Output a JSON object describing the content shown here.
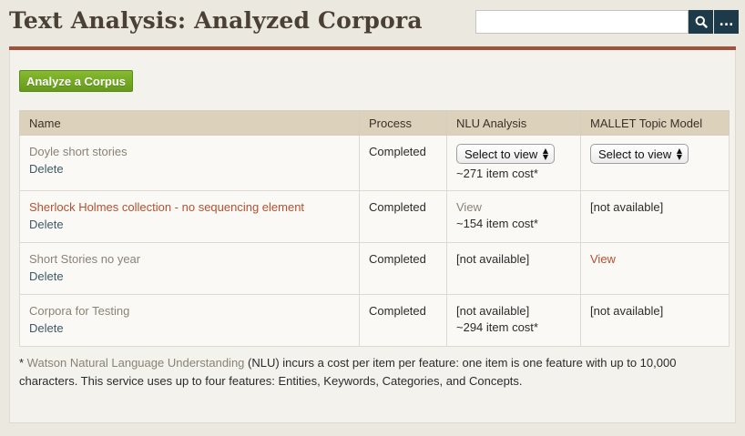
{
  "header": {
    "title": "Text Analysis: Analyzed Corpora",
    "search_placeholder": "",
    "search_icon": "magnifier",
    "more_label": "..."
  },
  "colors": {
    "accent_rule": "#a0533a",
    "button_green": "#75aa25",
    "search_button": "#1c3a4a",
    "active_link": "#b5502f",
    "muted_link": "#8a8276"
  },
  "actions": {
    "analyze_label": "Analyze a Corpus"
  },
  "table": {
    "headers": [
      "Name",
      "Process",
      "NLU Analysis",
      "MALLET Topic Model"
    ],
    "rows": [
      {
        "name": "Doyle short stories",
        "delete": "Delete",
        "process": "Completed",
        "nlu_select": "Select to view",
        "nlu_cost": "~271 item cost*",
        "mallet_select": "Select to view"
      },
      {
        "name": "Sherlock Holmes collection - no sequencing element",
        "delete": "Delete",
        "process": "Completed",
        "nlu_view": "View",
        "nlu_cost": "~154 item cost*",
        "mallet": "[not available]"
      },
      {
        "name": "Short Stories no year",
        "delete": "Delete",
        "process": "Completed",
        "nlu": "[not available]",
        "mallet_view": "View"
      },
      {
        "name": "Corpora for Testing",
        "delete": "Delete",
        "process": "Completed",
        "nlu": "[not available]",
        "nlu_cost": "~294 item cost*",
        "mallet": "[not available]"
      }
    ]
  },
  "footnote": {
    "prefix": "* ",
    "link": "Watson Natural Language Understanding",
    "rest": " (NLU) incurs a cost per item per feature: one item is one feature with up to 10,000 characters. This service uses up to four features: Entities, Keywords, Categories, and Concepts."
  }
}
